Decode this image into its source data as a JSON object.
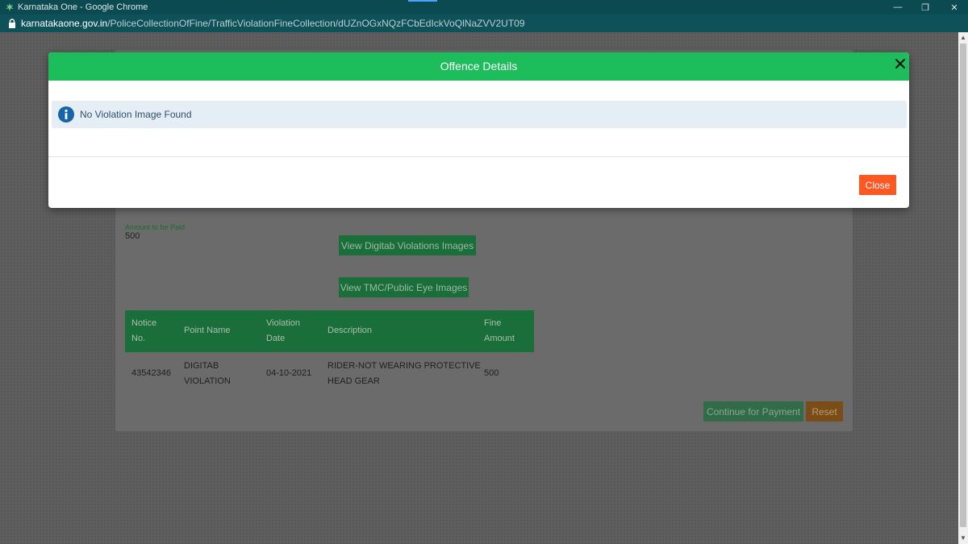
{
  "browser": {
    "window_title": "Karnataka One - Google Chrome",
    "url_domain": "karnatakaone.gov.in",
    "url_path": "/PoliceCollectionOfFine/TrafficViolationFineCollection/dUZnOGxNQzFCbEdIckVoQlNaZVV2UT09",
    "controls": {
      "minimize": "—",
      "restore": "❐",
      "close": "✕"
    }
  },
  "page": {
    "amount_label": "Amount to be Paid",
    "amount_value": "500",
    "amount_faint": "",
    "view_digitab_button": "View Digitab Violations Images",
    "view_tmc_button": "View TMC/Public Eye Images",
    "table": {
      "headers": [
        [
          "Notice",
          "No."
        ],
        [
          "Point Name"
        ],
        [
          "Violation",
          "Date"
        ],
        [
          "Description"
        ],
        [
          "Fine",
          "Amount"
        ]
      ],
      "rows": [
        {
          "notice_no": "43542346",
          "point_name": [
            "DIGITAB",
            "VIOLATION"
          ],
          "violation_date": "04-10-2021",
          "description": [
            "RIDER-NOT WEARING PROTECTIVE",
            "HEAD GEAR"
          ],
          "fine_amount": "500"
        }
      ]
    },
    "continue_button": "Continue for Payment",
    "reset_button": "Reset"
  },
  "modal": {
    "title": "Offence Details",
    "close_x": "✕",
    "alert_text": "No Violation Image Found",
    "close_button": "Close"
  },
  "colors": {
    "modal_header": "#1dbd5c",
    "close_button": "#ff5722",
    "info_blue": "#1565a8"
  }
}
